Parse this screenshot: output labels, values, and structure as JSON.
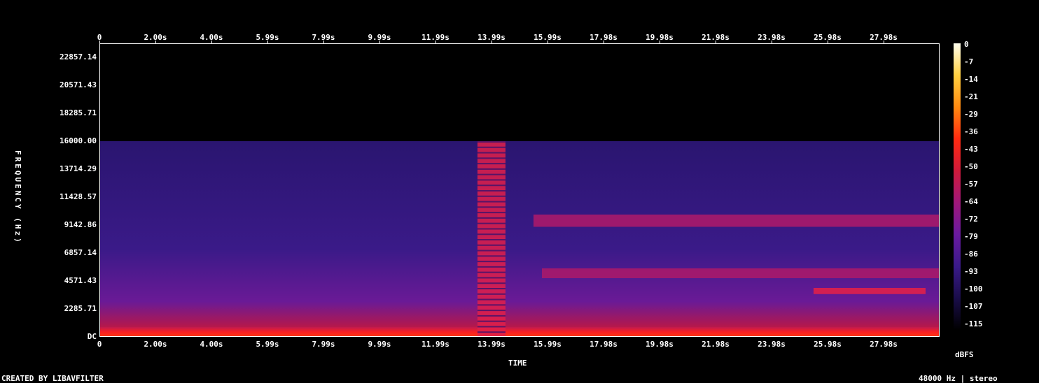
{
  "chart_data": {
    "type": "heatmap",
    "title": "",
    "xlabel": "TIME",
    "ylabel": "FREQUENCY (Hz)",
    "x_ticks": [
      "0",
      "2.00s",
      "4.00s",
      "5.99s",
      "7.99s",
      "9.99s",
      "11.99s",
      "13.99s",
      "15.99s",
      "17.98s",
      "19.98s",
      "21.98s",
      "23.98s",
      "25.98s",
      "27.98s"
    ],
    "y_ticks": [
      "22857.14",
      "20571.43",
      "18285.71",
      "16000.00",
      "13714.29",
      "11428.57",
      "9142.86",
      "6857.14",
      "4571.43",
      "2285.71",
      "DC"
    ],
    "xlim": [
      0,
      30.0
    ],
    "ylim": [
      0,
      24000
    ],
    "content_cutoff_hz": 16000,
    "colorbar": {
      "label": "dBFS",
      "ticks": [
        "0",
        "-7",
        "-14",
        "-21",
        "-29",
        "-36",
        "-43",
        "-50",
        "-57",
        "-64",
        "-72",
        "-79",
        "-86",
        "-93",
        "-100",
        "-107",
        "-115"
      ],
      "range": [
        -115,
        0
      ],
      "colors": [
        "#000000",
        "#1a0d4a",
        "#3a1a8a",
        "#6a1aa0",
        "#a0187a",
        "#d01a3a",
        "#ff2a10",
        "#ff8a10",
        "#ffd040",
        "#fffff0"
      ]
    },
    "features": [
      {
        "name": "low band",
        "t_start": 0,
        "t_end": 30.0,
        "f_low": 0,
        "f_high": 800,
        "db": -40
      },
      {
        "name": "broadband burst",
        "t_start": 13.5,
        "t_end": 14.5,
        "f_low": 0,
        "f_high": 16000,
        "db": -55
      },
      {
        "name": "band 9.5k",
        "t_start": 15.5,
        "t_end": 30.0,
        "f_low": 9000,
        "f_high": 10000,
        "db": -72
      },
      {
        "name": "band 5k",
        "t_start": 15.8,
        "t_end": 30.0,
        "f_low": 4800,
        "f_high": 5600,
        "db": -70
      },
      {
        "name": "band 3.8k",
        "t_start": 25.5,
        "t_end": 29.5,
        "f_low": 3500,
        "f_high": 4000,
        "db": -55
      }
    ]
  },
  "footer": {
    "left": "CREATED BY LIBAVFILTER",
    "right": "48000 Hz | stereo"
  }
}
